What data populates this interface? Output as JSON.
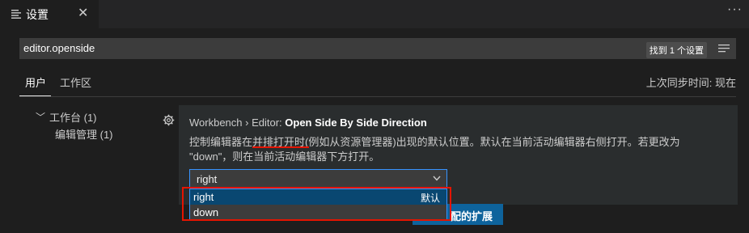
{
  "tab": {
    "title": "设置",
    "close": "✕"
  },
  "header": {
    "more": "···"
  },
  "search": {
    "value": "editor.openside",
    "count": "找到 1 个设置"
  },
  "scopes": {
    "user": "用户",
    "workspace": "工作区",
    "last_sync": "上次同步时间: 现在"
  },
  "toc": {
    "arrow": "﹀",
    "group": "工作台 (1)",
    "item": "编辑管理 (1)"
  },
  "setting": {
    "category": "Workbench › Editor: ",
    "name": "Open Side By Side Direction",
    "description_line1": "控制编辑器在并排打开时(例如从资源管理器)出现的默认位置。默认在当前活动编辑器右侧打开。若更改为",
    "description_line2": "\"down\"，则在当前活动编辑器下方打开。",
    "selected": "right",
    "options": [
      {
        "label": "right",
        "badge": "默认"
      },
      {
        "label": "down",
        "badge": ""
      }
    ]
  },
  "button": {
    "label": "配的扩展"
  },
  "colors": {
    "accent": "#3794ff",
    "highlight_red": "#e51400",
    "selected_option": "#094771",
    "button": "#0e639c"
  }
}
